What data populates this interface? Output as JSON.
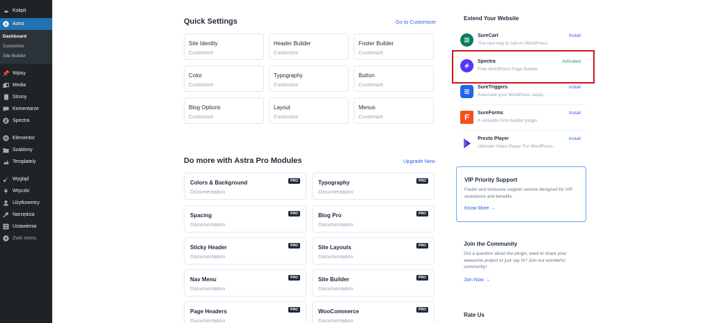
{
  "sidebar": {
    "top_items": [
      {
        "label": "Kokpit",
        "icon": "dashboard-icon"
      }
    ],
    "astra": {
      "label": "Astra",
      "icon": "astra-icon"
    },
    "astra_sub": [
      "Dashboard",
      "Customize",
      "Site Builder"
    ],
    "items": [
      {
        "label": "Wpisy",
        "icon": "pin-icon"
      },
      {
        "label": "Media",
        "icon": "media-icon"
      },
      {
        "label": "Strony",
        "icon": "pages-icon"
      },
      {
        "label": "Komentarze",
        "icon": "comments-icon"
      },
      {
        "label": "Spectra",
        "icon": "spectra-icon"
      }
    ],
    "items2": [
      {
        "label": "Elementor",
        "icon": "elementor-icon"
      },
      {
        "label": "Szablony",
        "icon": "folder-icon"
      },
      {
        "label": "Templately",
        "icon": "templately-icon"
      }
    ],
    "items3": [
      {
        "label": "Wygląd",
        "icon": "brush-icon"
      },
      {
        "label": "Wtyczki",
        "icon": "plug-icon"
      },
      {
        "label": "Użytkownicy",
        "icon": "users-icon"
      },
      {
        "label": "Narzędzia",
        "icon": "wrench-icon"
      },
      {
        "label": "Ustawienia",
        "icon": "settings-icon"
      }
    ],
    "collapse": "Zwiń menu"
  },
  "quick_settings": {
    "title": "Quick Settings",
    "link": "Go to Customizer",
    "cards": [
      {
        "title": "Site Identity",
        "sub": "Customize"
      },
      {
        "title": "Header Builder",
        "sub": "Customize"
      },
      {
        "title": "Footer Builder",
        "sub": "Customize"
      },
      {
        "title": "Color",
        "sub": "Customize"
      },
      {
        "title": "Typography",
        "sub": "Customize"
      },
      {
        "title": "Button",
        "sub": "Customize"
      },
      {
        "title": "Blog Options",
        "sub": "Customize"
      },
      {
        "title": "Layout",
        "sub": "Customize"
      },
      {
        "title": "Menus",
        "sub": "Customize"
      }
    ]
  },
  "pro_modules": {
    "title": "Do more with Astra Pro Modules",
    "link": "Upgrade Now",
    "badge": "PRO",
    "cards": [
      {
        "title": "Colors & Background",
        "sub": "Documentation"
      },
      {
        "title": "Typography",
        "sub": "Documentation"
      },
      {
        "title": "Spacing",
        "sub": "Documentation"
      },
      {
        "title": "Blog Pro",
        "sub": "Documentation"
      },
      {
        "title": "Sticky Header",
        "sub": "Documentation"
      },
      {
        "title": "Site Layouts",
        "sub": "Documentation"
      },
      {
        "title": "Nav Menu",
        "sub": "Documentation"
      },
      {
        "title": "Site Builder",
        "sub": "Documentation"
      },
      {
        "title": "Page Headers",
        "sub": "Documentation"
      },
      {
        "title": "WooCommerce",
        "sub": "Documentation"
      }
    ]
  },
  "extend": {
    "title": "Extend Your Website",
    "plugins": [
      {
        "name": "SureCart",
        "desc": "The new way to sell on WordPress.",
        "action": "Install",
        "color": "#0f7a5f",
        "logo": "S"
      },
      {
        "name": "Spectra",
        "desc": "Free WordPress Page Builder.",
        "action": "Activated",
        "color": "#5733ff",
        "logo": "S"
      },
      {
        "name": "SureTriggers",
        "desc": "Automate your WordPress setup.",
        "action": "Install",
        "color": "#2563eb",
        "logo": "S"
      },
      {
        "name": "SureForms",
        "desc": "A versatile form builder plugin.",
        "action": "Install",
        "color": "#f4511e",
        "logo": "F"
      },
      {
        "name": "Presto Player",
        "desc": "Ultimate Video Player For WordPress.",
        "action": "Install",
        "color": "#ffffff",
        "logo": "▶"
      }
    ]
  },
  "vip": {
    "title": "VIP Priority Support",
    "text": "Faster and exclusive support service designed for VIP assistance and benefits.",
    "link": "Know More →"
  },
  "community": {
    "title": "Join the Community",
    "text": "Got a question about the plugin, want to share your awesome project or just say hi? Join our wonderful community!",
    "link": "Join Now →"
  },
  "rate": {
    "title": "Rate Us"
  }
}
